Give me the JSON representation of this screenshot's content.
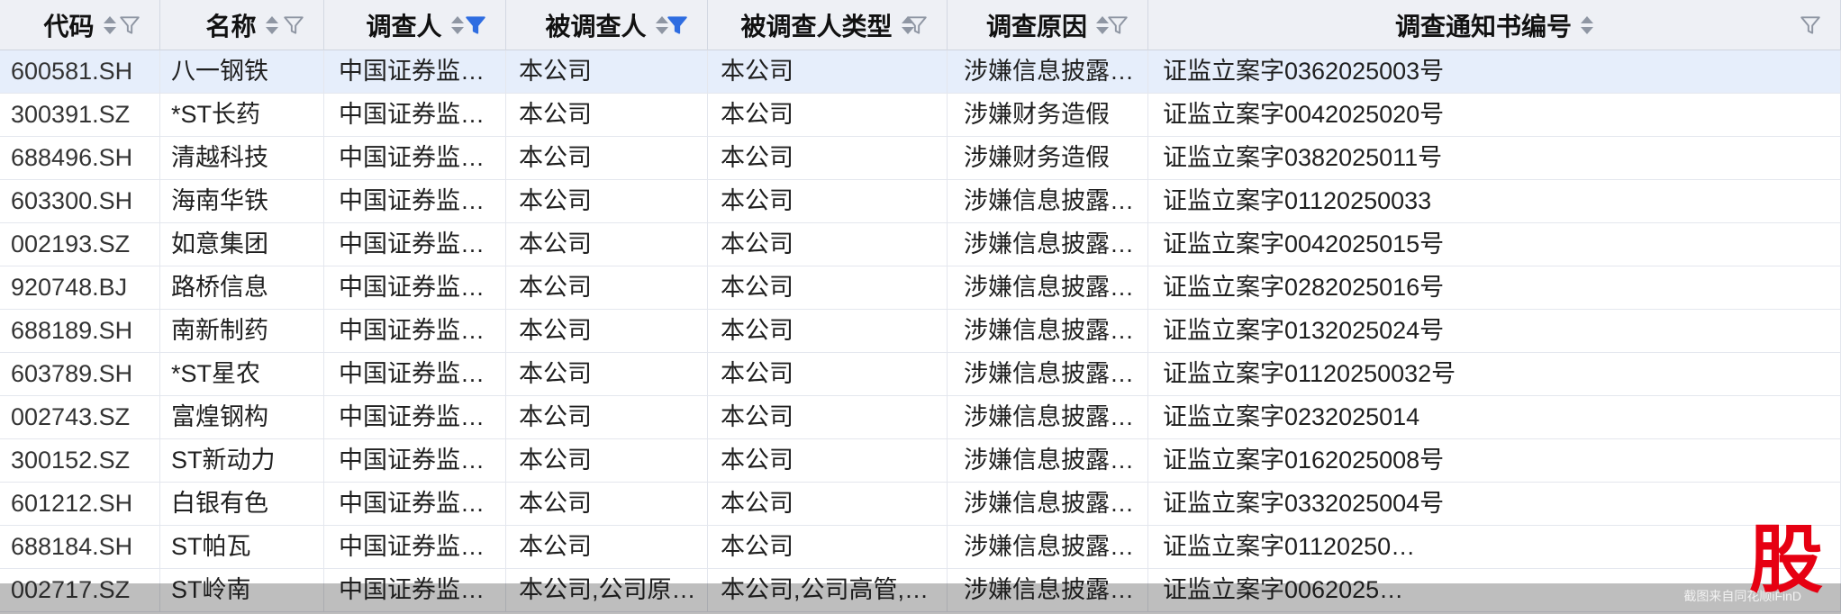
{
  "columns": [
    {
      "label": "代码",
      "filter_active": false
    },
    {
      "label": "名称",
      "filter_active": false
    },
    {
      "label": "调查人",
      "filter_active": true
    },
    {
      "label": "被调查人",
      "filter_active": true
    },
    {
      "label": "被调查人类型",
      "filter_active": false
    },
    {
      "label": "调查原因",
      "filter_active": false
    },
    {
      "label": "调查通知书编号",
      "filter_active": false
    }
  ],
  "rows": [
    [
      "600581.SH",
      "八一钢铁",
      "中国证券监督管…",
      "本公司",
      "本公司",
      "涉嫌信息披露违规",
      "证监立案字0362025003号"
    ],
    [
      "300391.SZ",
      "*ST长药",
      "中国证券监督管…",
      "本公司",
      "本公司",
      "涉嫌财务造假",
      "证监立案字0042025020号"
    ],
    [
      "688496.SH",
      "清越科技",
      "中国证券监督管…",
      "本公司",
      "本公司",
      "涉嫌财务造假",
      "证监立案字0382025011号"
    ],
    [
      "603300.SH",
      "海南华铁",
      "中国证券监督管…",
      "本公司",
      "本公司",
      "涉嫌信息披露违规",
      "证监立案字01120250033"
    ],
    [
      "002193.SZ",
      "如意集团",
      "中国证券监督管…",
      "本公司",
      "本公司",
      "涉嫌信息披露违规",
      "证监立案字0042025015号"
    ],
    [
      "920748.BJ",
      "路桥信息",
      "中国证券监督管…",
      "本公司",
      "本公司",
      "涉嫌信息披露违规",
      "证监立案字0282025016号"
    ],
    [
      "688189.SH",
      "南新制药",
      "中国证券监督管…",
      "本公司",
      "本公司",
      "涉嫌信息披露违规",
      "证监立案字0132025024号"
    ],
    [
      "603789.SH",
      "*ST星农",
      "中国证券监督管…",
      "本公司",
      "本公司",
      "涉嫌信息披露违规",
      "证监立案字01120250032号"
    ],
    [
      "002743.SZ",
      "富煌钢构",
      "中国证券监督管…",
      "本公司",
      "本公司",
      "涉嫌信息披露违规",
      "证监立案字0232025014"
    ],
    [
      "300152.SZ",
      "ST新动力",
      "中国证券监督管…",
      "本公司",
      "本公司",
      "涉嫌信息披露违规",
      "证监立案字0162025008号"
    ],
    [
      "601212.SH",
      "白银有色",
      "中国证券监督管…",
      "本公司",
      "本公司",
      "涉嫌信息披露违规",
      "证监立案字0332025004号"
    ],
    [
      "688184.SH",
      "ST帕瓦",
      "中国证券监督管…",
      "本公司",
      "本公司",
      "涉嫌信息披露违规",
      "证监立案字01120250…"
    ],
    [
      "002717.SZ",
      "ST岭南",
      "中国证券监督管…",
      "本公司,公司原控…",
      "本公司,公司高管,公司…",
      "涉嫌信息披露违规",
      "证监立案字0062025…"
    ]
  ],
  "selected_row_index": 0,
  "watermark": {
    "text": "截图来自同花顺iFinD",
    "logo": "股"
  },
  "colors": {
    "header_bg": "#eef0f5",
    "selected_row_bg": "#e6eefb",
    "filter_active": "#2f6de1",
    "filter_inactive": "#8f96a3",
    "logo_red": "#e60012"
  },
  "icons": {
    "sort": "sort-arrows-icon",
    "filter": "funnel-filter-icon"
  }
}
